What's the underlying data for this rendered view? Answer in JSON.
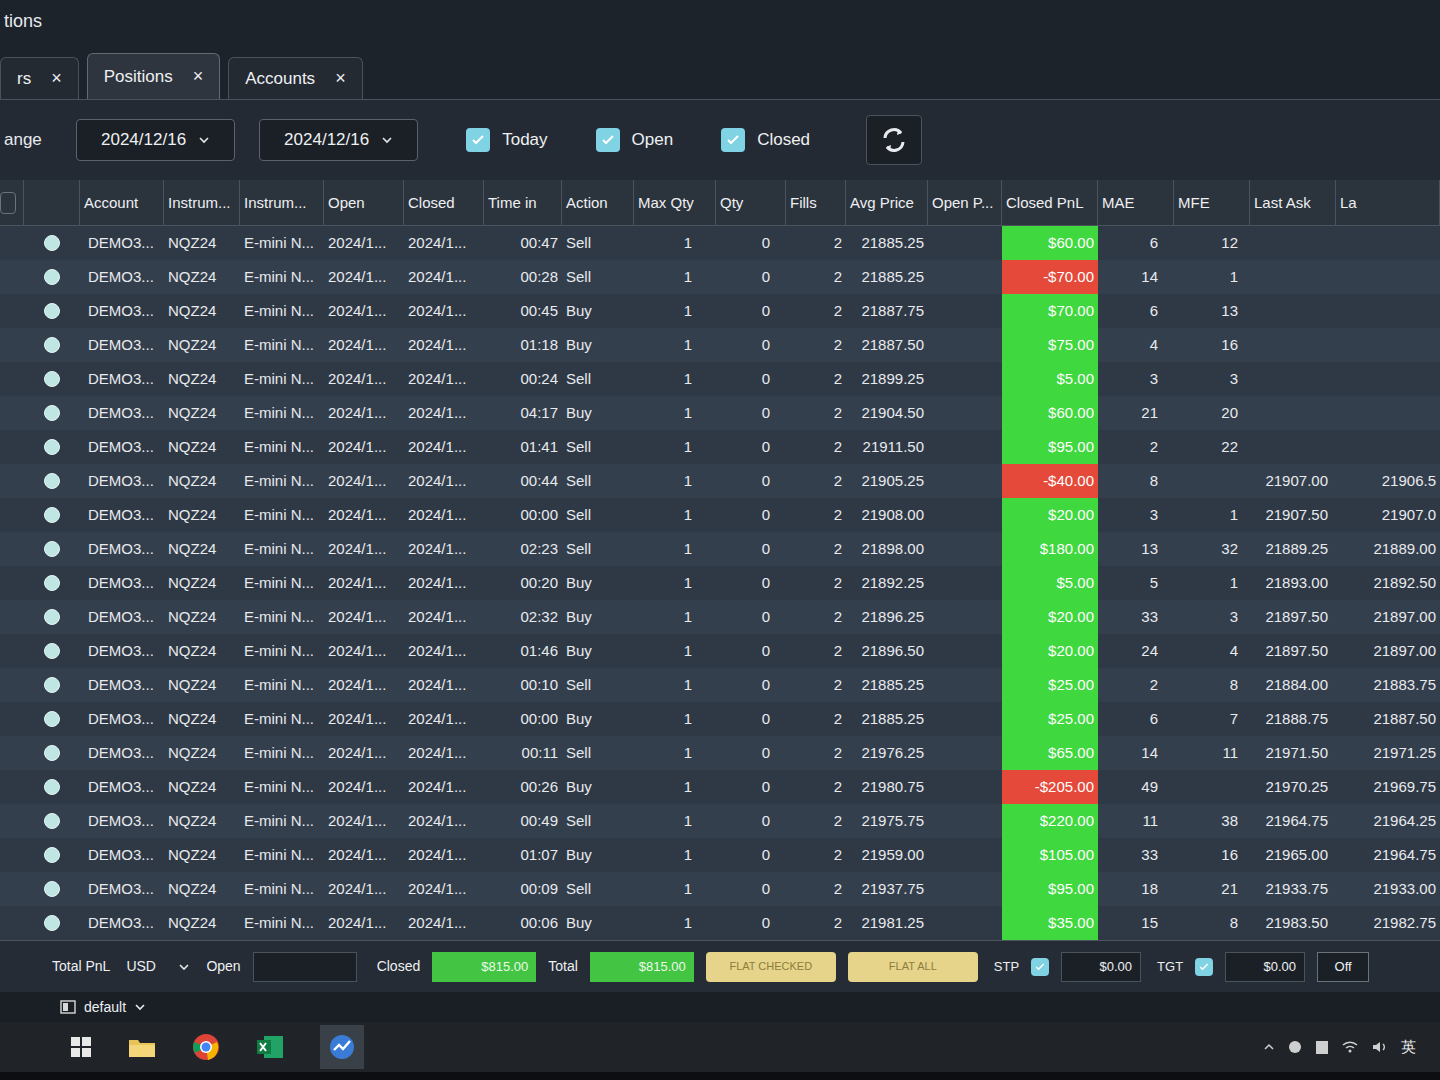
{
  "window": {
    "title": "tions"
  },
  "tabs": [
    {
      "label": "rs",
      "close": "×",
      "selected": false
    },
    {
      "label": "Positions",
      "close": "×",
      "selected": true
    },
    {
      "label": "Accounts",
      "close": "×",
      "selected": false
    }
  ],
  "filter": {
    "range_label": "ange",
    "from": "2024/12/16",
    "to": "2024/12/16",
    "options": [
      {
        "label": "Today",
        "checked": true
      },
      {
        "label": "Open",
        "checked": true
      },
      {
        "label": "Closed",
        "checked": true
      }
    ]
  },
  "table": {
    "columns": [
      "Account",
      "Instrum...",
      "Instrum...",
      "Open",
      "Closed",
      "Time in",
      "Action",
      "Max Qty",
      "Qty",
      "Fills",
      "Avg Price",
      "Open P...",
      "Closed PnL",
      "MAE",
      "MFE",
      "Last Ask",
      "La"
    ],
    "rows": [
      {
        "account": "DEMO3...",
        "symbol": "NQZ24",
        "instrument": "E-mini N...",
        "open": "2024/1...",
        "closed": "2024/1...",
        "time_in": "00:47",
        "action": "Sell",
        "max_qty": "1",
        "qty": "0",
        "fills": "2",
        "avg_price": "21885.25",
        "closed_pnl": "$60.00",
        "color": "#3fd83f",
        "mae": "6",
        "mfe": "12"
      },
      {
        "account": "DEMO3...",
        "symbol": "NQZ24",
        "instrument": "E-mini N...",
        "open": "2024/1...",
        "closed": "2024/1...",
        "time_in": "00:28",
        "action": "Sell",
        "max_qty": "1",
        "qty": "0",
        "fills": "2",
        "avg_price": "21885.25",
        "closed_pnl": "-$70.00",
        "color": "#e5493a",
        "mae": "14",
        "mfe": "1"
      },
      {
        "account": "DEMO3...",
        "symbol": "NQZ24",
        "instrument": "E-mini N...",
        "open": "2024/1...",
        "closed": "2024/1...",
        "time_in": "00:45",
        "action": "Buy",
        "max_qty": "1",
        "qty": "0",
        "fills": "2",
        "avg_price": "21887.75",
        "closed_pnl": "$70.00",
        "color": "#3fd83f",
        "mae": "6",
        "mfe": "13"
      },
      {
        "account": "DEMO3...",
        "symbol": "NQZ24",
        "instrument": "E-mini N...",
        "open": "2024/1...",
        "closed": "2024/1...",
        "time_in": "01:18",
        "action": "Buy",
        "max_qty": "1",
        "qty": "0",
        "fills": "2",
        "avg_price": "21887.50",
        "closed_pnl": "$75.00",
        "color": "#3fd83f",
        "mae": "4",
        "mfe": "16"
      },
      {
        "account": "DEMO3...",
        "symbol": "NQZ24",
        "instrument": "E-mini N...",
        "open": "2024/1...",
        "closed": "2024/1...",
        "time_in": "00:24",
        "action": "Sell",
        "max_qty": "1",
        "qty": "0",
        "fills": "2",
        "avg_price": "21899.25",
        "closed_pnl": "$5.00",
        "color": "#3fd83f",
        "mae": "3",
        "mfe": "3"
      },
      {
        "account": "DEMO3...",
        "symbol": "NQZ24",
        "instrument": "E-mini N...",
        "open": "2024/1...",
        "closed": "2024/1...",
        "time_in": "04:17",
        "action": "Buy",
        "max_qty": "1",
        "qty": "0",
        "fills": "2",
        "avg_price": "21904.50",
        "closed_pnl": "$60.00",
        "color": "#3fd83f",
        "mae": "21",
        "mfe": "20"
      },
      {
        "account": "DEMO3...",
        "symbol": "NQZ24",
        "instrument": "E-mini N...",
        "open": "2024/1...",
        "closed": "2024/1...",
        "time_in": "01:41",
        "action": "Sell",
        "max_qty": "1",
        "qty": "0",
        "fills": "2",
        "avg_price": "21911.50",
        "closed_pnl": "$95.00",
        "color": "#3fd83f",
        "mae": "2",
        "mfe": "22"
      },
      {
        "account": "DEMO3...",
        "symbol": "NQZ24",
        "instrument": "E-mini N...",
        "open": "2024/1...",
        "closed": "2024/1...",
        "time_in": "00:44",
        "action": "Sell",
        "max_qty": "1",
        "qty": "0",
        "fills": "2",
        "avg_price": "21905.25",
        "closed_pnl": "-$40.00",
        "color": "#e5493a",
        "mae": "8",
        "last_ask": "21907.00",
        "last": "21906.5"
      },
      {
        "account": "DEMO3...",
        "symbol": "NQZ24",
        "instrument": "E-mini N...",
        "open": "2024/1...",
        "closed": "2024/1...",
        "time_in": "00:00",
        "action": "Sell",
        "max_qty": "1",
        "qty": "0",
        "fills": "2",
        "avg_price": "21908.00",
        "closed_pnl": "$20.00",
        "color": "#3fd83f",
        "mae": "3",
        "mfe": "1",
        "last_ask": "21907.50",
        "last": "21907.0"
      },
      {
        "account": "DEMO3...",
        "symbol": "NQZ24",
        "instrument": "E-mini N...",
        "open": "2024/1...",
        "closed": "2024/1...",
        "time_in": "02:23",
        "action": "Sell",
        "max_qty": "1",
        "qty": "0",
        "fills": "2",
        "avg_price": "21898.00",
        "closed_pnl": "$180.00",
        "color": "#3fd83f",
        "mae": "13",
        "mfe": "32",
        "last_ask": "21889.25",
        "last": "21889.00"
      },
      {
        "account": "DEMO3...",
        "symbol": "NQZ24",
        "instrument": "E-mini N...",
        "open": "2024/1...",
        "closed": "2024/1...",
        "time_in": "00:20",
        "action": "Buy",
        "max_qty": "1",
        "qty": "0",
        "fills": "2",
        "avg_price": "21892.25",
        "closed_pnl": "$5.00",
        "color": "#3fd83f",
        "mae": "5",
        "mfe": "1",
        "last_ask": "21893.00",
        "last": "21892.50"
      },
      {
        "account": "DEMO3...",
        "symbol": "NQZ24",
        "instrument": "E-mini N...",
        "open": "2024/1...",
        "closed": "2024/1...",
        "time_in": "02:32",
        "action": "Buy",
        "max_qty": "1",
        "qty": "0",
        "fills": "2",
        "avg_price": "21896.25",
        "closed_pnl": "$20.00",
        "color": "#3fd83f",
        "mae": "33",
        "mfe": "3",
        "last_ask": "21897.50",
        "last": "21897.00"
      },
      {
        "account": "DEMO3...",
        "symbol": "NQZ24",
        "instrument": "E-mini N...",
        "open": "2024/1...",
        "closed": "2024/1...",
        "time_in": "01:46",
        "action": "Buy",
        "max_qty": "1",
        "qty": "0",
        "fills": "2",
        "avg_price": "21896.50",
        "closed_pnl": "$20.00",
        "color": "#3fd83f",
        "mae": "24",
        "mfe": "4",
        "last_ask": "21897.50",
        "last": "21897.00"
      },
      {
        "account": "DEMO3...",
        "symbol": "NQZ24",
        "instrument": "E-mini N...",
        "open": "2024/1...",
        "closed": "2024/1...",
        "time_in": "00:10",
        "action": "Sell",
        "max_qty": "1",
        "qty": "0",
        "fills": "2",
        "avg_price": "21885.25",
        "closed_pnl": "$25.00",
        "color": "#3fd83f",
        "mae": "2",
        "mfe": "8",
        "last_ask": "21884.00",
        "last": "21883.75"
      },
      {
        "account": "DEMO3...",
        "symbol": "NQZ24",
        "instrument": "E-mini N...",
        "open": "2024/1...",
        "closed": "2024/1...",
        "time_in": "00:00",
        "action": "Buy",
        "max_qty": "1",
        "qty": "0",
        "fills": "2",
        "avg_price": "21885.25",
        "closed_pnl": "$25.00",
        "color": "#3fd83f",
        "mae": "6",
        "mfe": "7",
        "last_ask": "21888.75",
        "last": "21887.50"
      },
      {
        "account": "DEMO3...",
        "symbol": "NQZ24",
        "instrument": "E-mini N...",
        "open": "2024/1...",
        "closed": "2024/1...",
        "time_in": "00:11",
        "action": "Sell",
        "max_qty": "1",
        "qty": "0",
        "fills": "2",
        "avg_price": "21976.25",
        "closed_pnl": "$65.00",
        "color": "#3fd83f",
        "mae": "14",
        "mfe": "11",
        "last_ask": "21971.50",
        "last": "21971.25"
      },
      {
        "account": "DEMO3...",
        "symbol": "NQZ24",
        "instrument": "E-mini N...",
        "open": "2024/1...",
        "closed": "2024/1...",
        "time_in": "00:26",
        "action": "Buy",
        "max_qty": "1",
        "qty": "0",
        "fills": "2",
        "avg_price": "21980.75",
        "closed_pnl": "-$205.00",
        "color": "#e5493a",
        "mae": "49",
        "last_ask": "21970.25",
        "last": "21969.75"
      },
      {
        "account": "DEMO3...",
        "symbol": "NQZ24",
        "instrument": "E-mini N...",
        "open": "2024/1...",
        "closed": "2024/1...",
        "time_in": "00:49",
        "action": "Sell",
        "max_qty": "1",
        "qty": "0",
        "fills": "2",
        "avg_price": "21975.75",
        "closed_pnl": "$220.00",
        "color": "#3fd83f",
        "mae": "11",
        "mfe": "38",
        "last_ask": "21964.75",
        "last": "21964.25"
      },
      {
        "account": "DEMO3...",
        "symbol": "NQZ24",
        "instrument": "E-mini N...",
        "open": "2024/1...",
        "closed": "2024/1...",
        "time_in": "01:07",
        "action": "Buy",
        "max_qty": "1",
        "qty": "0",
        "fills": "2",
        "avg_price": "21959.00",
        "closed_pnl": "$105.00",
        "color": "#3fd83f",
        "mae": "33",
        "mfe": "16",
        "last_ask": "21965.00",
        "last": "21964.75"
      },
      {
        "account": "DEMO3...",
        "symbol": "NQZ24",
        "instrument": "E-mini N...",
        "open": "2024/1...",
        "closed": "2024/1...",
        "time_in": "00:09",
        "action": "Sell",
        "max_qty": "1",
        "qty": "0",
        "fills": "2",
        "avg_price": "21937.75",
        "closed_pnl": "$95.00",
        "color": "#3fd83f",
        "mae": "18",
        "mfe": "21",
        "last_ask": "21933.75",
        "last": "21933.00"
      },
      {
        "account": "DEMO3...",
        "symbol": "NQZ24",
        "instrument": "E-mini N...",
        "open": "2024/1...",
        "closed": "2024/1...",
        "time_in": "00:06",
        "action": "Buy",
        "max_qty": "1",
        "qty": "0",
        "fills": "2",
        "avg_price": "21981.25",
        "closed_pnl": "$35.00",
        "color": "#3fd83f",
        "mae": "15",
        "mfe": "8",
        "last_ask": "21983.50",
        "last": "21982.75"
      }
    ]
  },
  "footer": {
    "total_pnl_label": "Total PnL",
    "currency": "USD",
    "open_label": "Open",
    "closed_label": "Closed",
    "closed_value": "$815.00",
    "total_label": "Total",
    "total_value": "$815.00",
    "buttons": [
      "FLAT CHECKED",
      "FLAT ALL"
    ],
    "stp": {
      "label": "STP",
      "checked": true,
      "value": "$0.00"
    },
    "tgt": {
      "label": "TGT",
      "checked": true,
      "value": "$0.00"
    },
    "off": "Off"
  },
  "workspace": {
    "label": "default"
  },
  "taskbar": {
    "ime": "英"
  }
}
